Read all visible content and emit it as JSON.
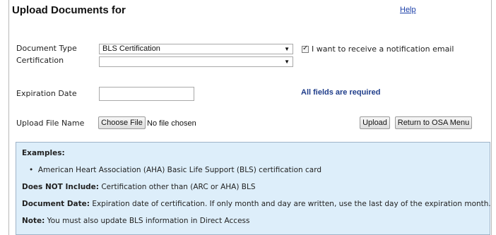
{
  "header": {
    "title": "Upload Documents for",
    "help_link": "Help"
  },
  "form": {
    "document_type_label": "Document Type",
    "document_type_value": "BLS Certification",
    "certification_label": "Certification",
    "certification_value": "",
    "notification_checkbox_label": "I want to receive a notification email",
    "notification_checked": true,
    "expiration_date_label": "Expiration Date",
    "expiration_date_value": "",
    "required_note": "All fields are required",
    "upload_file_label": "Upload File Name",
    "choose_file_label": "Choose File",
    "no_file_text": "No file chosen",
    "upload_button": "Upload",
    "return_button": "Return to OSA Menu"
  },
  "info": {
    "examples_heading": "Examples:",
    "example_item": "American Heart Association (AHA) Basic Life Support (BLS) certification card",
    "not_include_label": "Does NOT Include:",
    "not_include_text": " Certification other than (ARC or AHA) BLS",
    "document_date_label": "Document Date:",
    "document_date_text": " Expiration date of certification. If only month and day are written, use the last day of the expiration month.",
    "note_label": "Note:",
    "note_text": " You must also update BLS information in Direct Access"
  },
  "colors": {
    "info_background": "#ddeefa",
    "link_blue": "#1a3ea8",
    "required_blue": "#1f3d8a"
  }
}
